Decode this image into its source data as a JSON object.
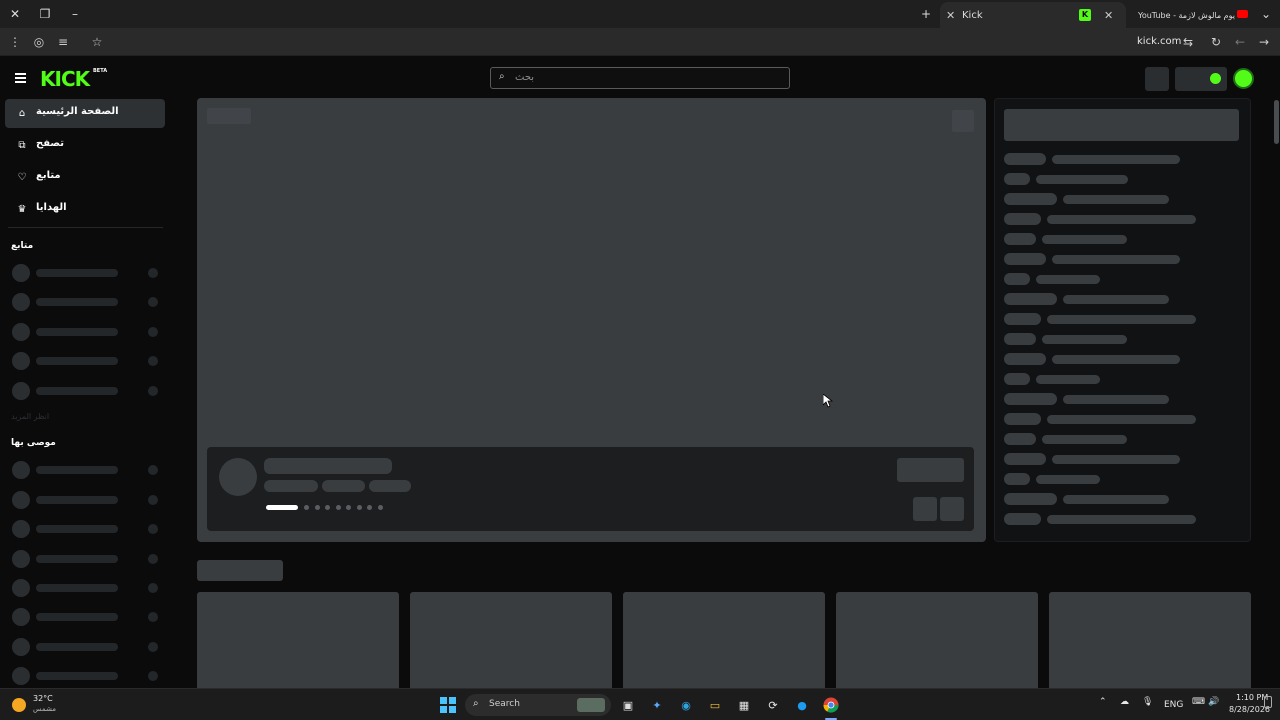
{
  "browser": {
    "tabs": [
      {
        "title": "Kick",
        "active": true,
        "favicon": "kick-logo-icon"
      },
      {
        "title": "YouTube - يوم مالوش لازمة",
        "active": false,
        "favicon": "youtube-icon"
      }
    ],
    "address": "kick.com",
    "window_controls": {
      "close": "✕",
      "restore": "❐",
      "minimize": "–"
    },
    "new_tab": "+",
    "tab_close": "✕",
    "tab_menu": "⌄"
  },
  "header": {
    "logo": "KICK",
    "logo_badge": "BETA",
    "search_placeholder": "بحث"
  },
  "sidebar": {
    "nav": [
      {
        "label": "الصفحة الرئيسية",
        "icon": "home-icon",
        "active": true
      },
      {
        "label": "تصفح",
        "icon": "browse-icon",
        "active": false
      },
      {
        "label": "متابع",
        "icon": "heart-icon",
        "active": false
      },
      {
        "label": "الهدايا",
        "icon": "gift-icon",
        "active": false
      }
    ],
    "following_title": "متابع",
    "recommended_title": "موصى بها",
    "faded_label": "انظر المزيد"
  },
  "taskbar": {
    "weather_temp": "32°C",
    "weather_desc": "مشمس",
    "search_label": "Search",
    "language": "ENG",
    "time": "1:10 PM",
    "date": "8/28/2026"
  },
  "colors": {
    "kick_green": "#53fc18",
    "skeleton": "#3a3d40",
    "background": "#0b0b0c"
  }
}
